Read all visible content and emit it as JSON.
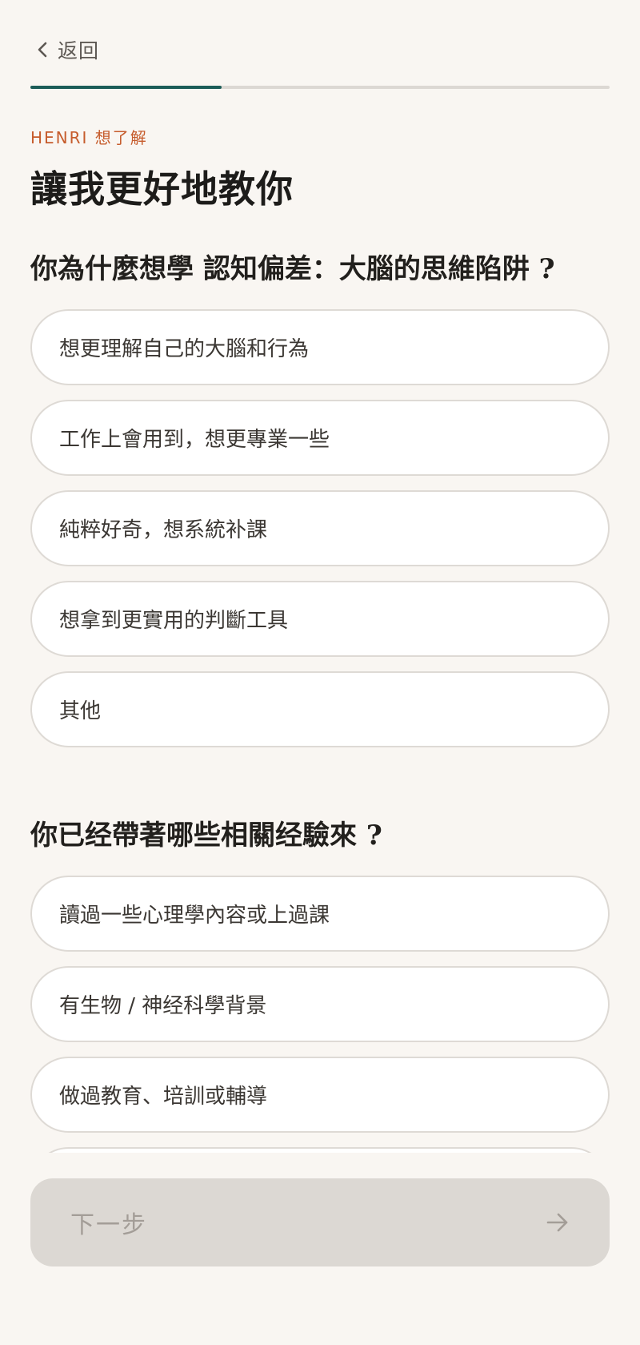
{
  "header": {
    "back_label": "返回",
    "progress": 0.33
  },
  "intro": {
    "eyebrow": "HENRI 想了解",
    "title": "讓我更好地教你"
  },
  "sections": [
    {
      "question": "你為什麼想學 認知偏差：大腦的思維陷阱 ?",
      "options": [
        "想更理解自己的大腦和行為",
        "工作上會用到，想更專業一些",
        "純粹好奇，想系統补課",
        "想拿到更實用的判斷工具",
        "其他"
      ]
    },
    {
      "question": "你已经帶著哪些相關经驗來 ?",
      "options": [
        "讀過一些心理學內容或上過課",
        "有生物 / 神经科學背景",
        "做過教育、培訓或輔導"
      ]
    }
  ],
  "footer": {
    "next_label": "下一步",
    "next_icon": "arrow-right-icon"
  },
  "colors": {
    "background": "#f9f6f2",
    "accent": "#1c5d58",
    "eyebrow": "#c65c2c",
    "button_disabled": "#dcd8d3"
  }
}
